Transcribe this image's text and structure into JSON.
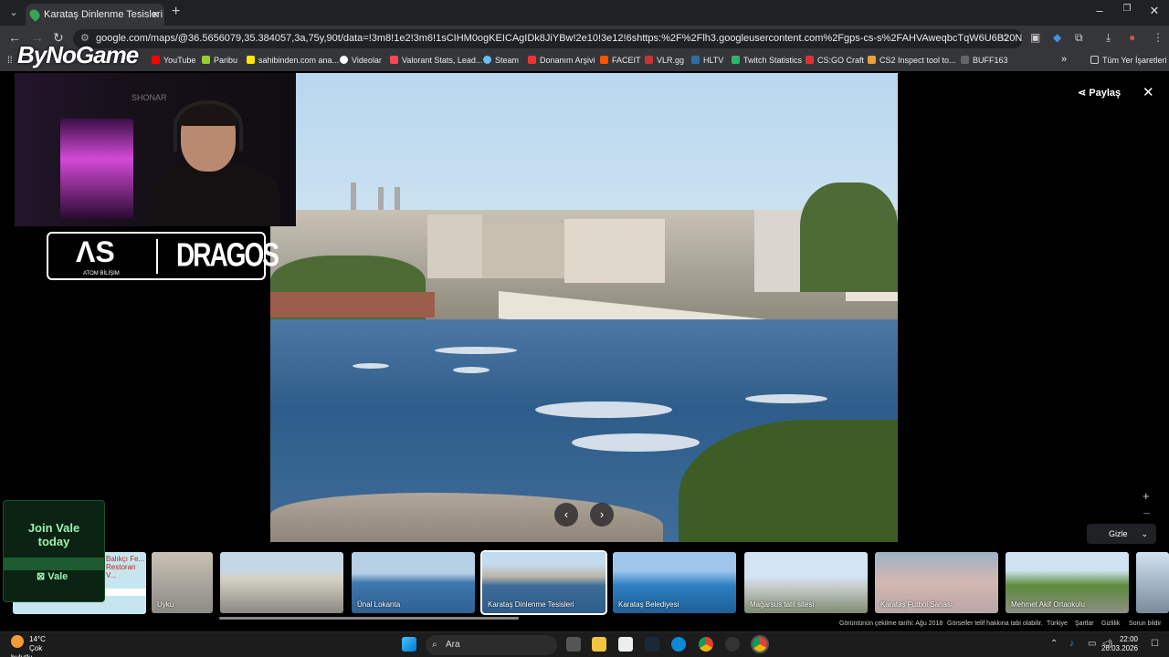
{
  "browser": {
    "tab_title": "Karataş Dinlenme Tesisleri - Go",
    "new_tab": "+",
    "url": "google.com/maps/@36.5656079,35.384057,3a,75y,90t/data=!3m8!1e2!3m6!1sCIHM0ogKEICAgIDk8JiYBw!2e10!3e12!6shttps:%2F%2Flh3.googleusercontent.com%2Fgps-cs-s%2FAHVAweqbcTqW6U6B20Nzee6G7_uAvWOOxnpafCDYc...",
    "minimize": "–",
    "restore": "❐",
    "close": "✕"
  },
  "bookmarks": [
    {
      "label": "YouTube",
      "color": "#ff0000"
    },
    {
      "label": "Paribu",
      "color": "#9acd32"
    },
    {
      "label": "sahibinden.com ana...",
      "color": "#ffe800"
    },
    {
      "label": "Videolar",
      "color": "#ffffff"
    },
    {
      "label": "Valorant Stats, Lead...",
      "color": "#ff4655"
    },
    {
      "label": "Steam",
      "color": "#1b2838"
    },
    {
      "label": "Donanım Arşivi",
      "color": "#e33"
    },
    {
      "label": "FACEIT",
      "color": "#ff5500"
    },
    {
      "label": "VLR.gg",
      "color": "#c33"
    },
    {
      "label": "HLTV",
      "color": "#2b6ea6"
    },
    {
      "label": "Twitch Statistics",
      "color": "#2fb46b"
    },
    {
      "label": "CS:GO Craft",
      "color": "#d33"
    },
    {
      "label": "CS2 Inspect tool to...",
      "color": "#e9a13b"
    },
    {
      "label": "BUFF163",
      "color": "#444"
    },
    {
      "label": "Tüm Yer İşaretleri",
      "color": "#888"
    }
  ],
  "viewer": {
    "share_label": "Paylaş",
    "close_label": "✕",
    "hide_label": "Gizle",
    "zoom_in": "+",
    "zoom_out": "–",
    "prev": "‹",
    "next": "›",
    "thumbnails": [
      {
        "label": "Uyku"
      },
      {
        "label": ""
      },
      {
        "label": "Ünal Lokanta"
      },
      {
        "label": "Karataş Dinlenme Tesisleri"
      },
      {
        "label": "Karataş Belediyesi"
      },
      {
        "label": "Mağarsus tatil sitesi"
      },
      {
        "label": "Karataş Futbol Sahası"
      },
      {
        "label": "Mehmet Akif Ortaokulu"
      }
    ],
    "map_label": "Balıkçı Fe... Restoran V...",
    "footer": {
      "date": "Görüntünün çekilme tarihi: Ağu 2018",
      "copyright": "Görseller telif hakkına tabi olabilir.",
      "country": "Türkiye",
      "terms": "Şartlar",
      "privacy": "Gizlilik",
      "report": "Sorun bildir"
    }
  },
  "overlay": {
    "logo": "ByNoGame",
    "cam_sign": "SHONAR",
    "sponsor_left": "ATOM BİLİŞİM",
    "sponsor_right": "DRAGOS",
    "join_text": "Join Vale today",
    "vale_label": "Vale"
  },
  "taskbar": {
    "temperature": "14°C",
    "weather": "Çok bulutlu",
    "search_placeholder": "Ara",
    "time": "22:00",
    "date": "26.03.2026"
  }
}
